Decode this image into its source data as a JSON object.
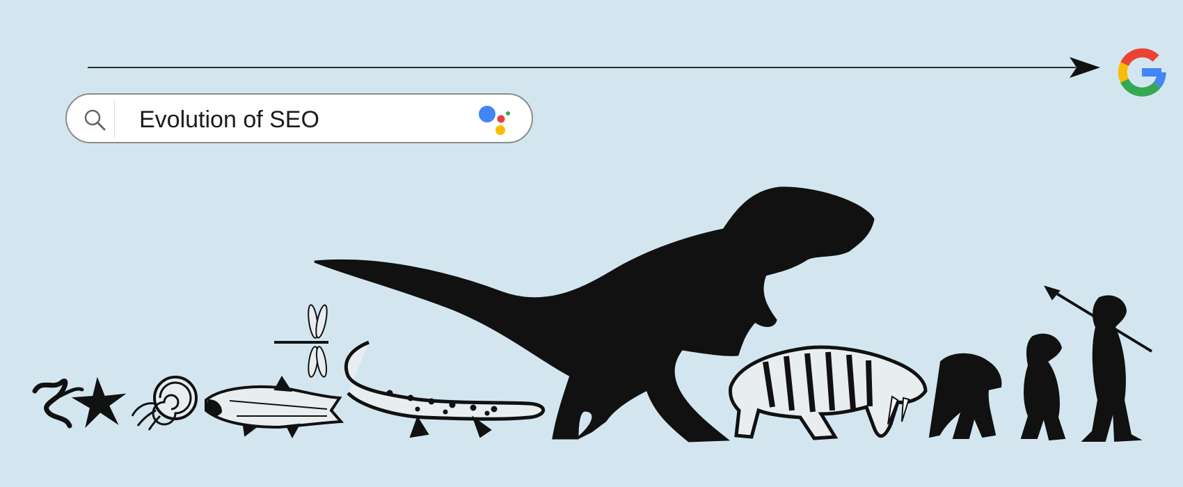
{
  "header": {
    "timeline_icon": "arrow-right-icon",
    "brand_icon": "google-g-icon",
    "brand_colors": [
      "#4285F4",
      "#EA4335",
      "#FBBC05",
      "#34A853"
    ]
  },
  "search": {
    "query": "Evolution of SEO",
    "search_icon": "search-icon",
    "assistant_icon": "google-assistant-icon"
  },
  "illustration": {
    "figures": [
      "worm",
      "starfish",
      "nautilus",
      "coelacanth-fish",
      "dragonfly",
      "amphibian",
      "tyrannosaurus-rex",
      "saber-tooth-tiger",
      "ape",
      "early-hominid",
      "caveman-with-spear"
    ]
  },
  "colors": {
    "background": "#d3e6f0",
    "ink": "#111111"
  }
}
